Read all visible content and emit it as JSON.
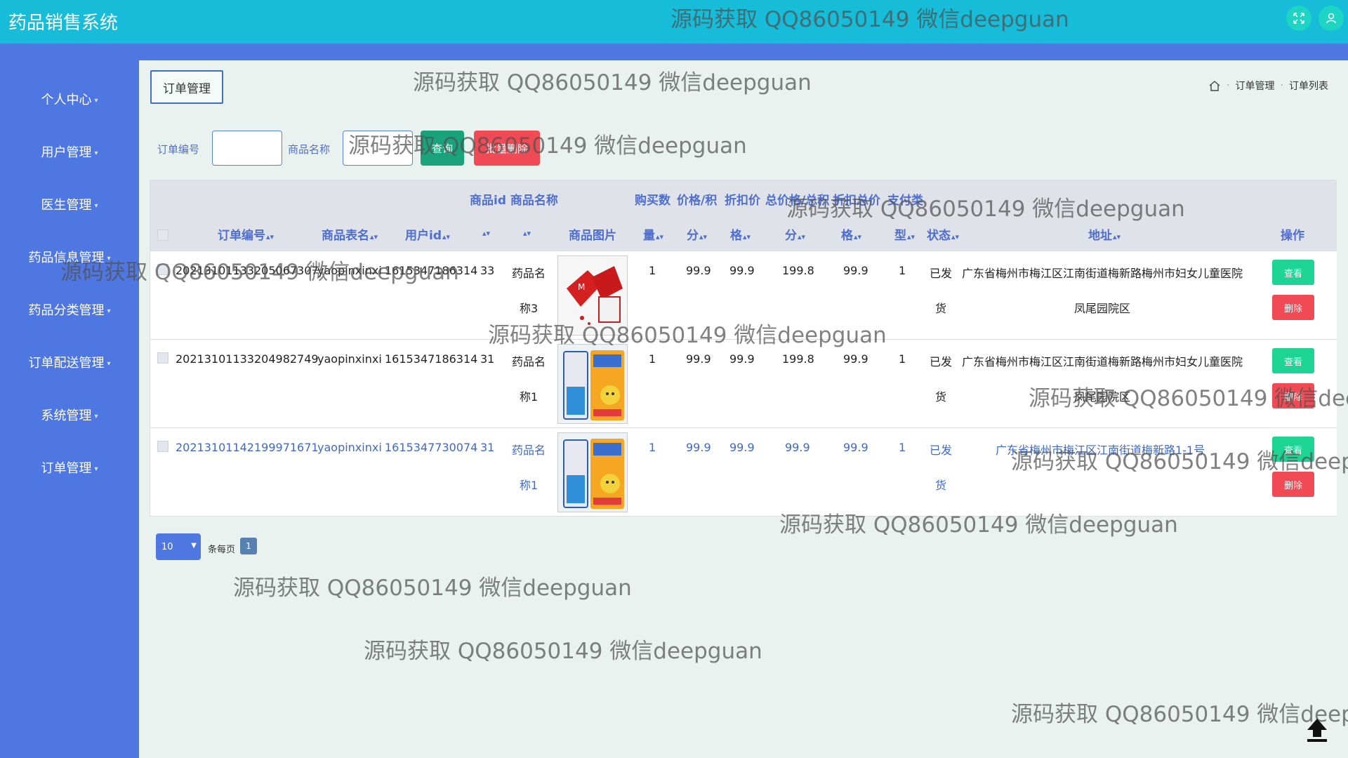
{
  "app": {
    "title": "药品销售系统"
  },
  "header_icons": [
    "fullscreen-icon",
    "user-icon"
  ],
  "sidebar": {
    "items": [
      {
        "label": "个人中心"
      },
      {
        "label": "用户管理"
      },
      {
        "label": "医生管理"
      },
      {
        "label": "药品信息管理"
      },
      {
        "label": "药品分类管理"
      },
      {
        "label": "订单配送管理"
      },
      {
        "label": "系统管理"
      },
      {
        "label": "订单管理"
      }
    ]
  },
  "page": {
    "tab_label": "订单管理",
    "breadcrumb": [
      "订单管理",
      "订单列表"
    ]
  },
  "search": {
    "order_no_label": "订单编号",
    "order_no_value": "",
    "product_name_label": "商品名称",
    "product_name_value": "",
    "query_button": "查询",
    "batch_delete_button": "批量删除"
  },
  "table": {
    "header_top": {
      "goods": "商品id 商品名称",
      "quantity": "购买数",
      "price": "价格/积",
      "discount": "折扣价",
      "total": "总价格/总积",
      "total_discount": "折扣总价",
      "payment": "支付类"
    },
    "header_bottom": {
      "order_no": "订单编号",
      "table_name": "商品表名",
      "user_id": "用户id",
      "goods_id": "",
      "goods_name": "",
      "image": "商品图片",
      "quantity": "量",
      "price": "分",
      "discount": "格",
      "total": "分",
      "total_discount": "格",
      "payment": "型",
      "status": "状态",
      "address": "地址",
      "actions": "操作"
    },
    "rows": [
      {
        "order_no": "20213101133205067307",
        "table_name": "yaopinxinxi",
        "user_id": "1615347186314",
        "goods_id": "33",
        "goods_name_1": "药品名",
        "goods_name_2": "称3",
        "quantity": "1",
        "price": "99.9",
        "discount": "99.9",
        "total": "199.8",
        "total_discount": "99.9",
        "payment": "1",
        "status_1": "已发",
        "status_2": "货",
        "address_1": "广东省梅州市梅江区江南街道梅新路梅州市妇女儿童医院",
        "address_2": "凤尾园院区",
        "view": "查看",
        "delete": "删除"
      },
      {
        "order_no": "20213101133204982749",
        "table_name": "yaopinxinxi",
        "user_id": "1615347186314",
        "goods_id": "31",
        "goods_name_1": "药品名",
        "goods_name_2": "称1",
        "quantity": "1",
        "price": "99.9",
        "discount": "99.9",
        "total": "199.8",
        "total_discount": "99.9",
        "payment": "1",
        "status_1": "已发",
        "status_2": "货",
        "address_1": "广东省梅州市梅江区江南街道梅新路梅州市妇女儿童医院",
        "address_2": "凤尾园院区",
        "view": "查看",
        "delete": "删除"
      },
      {
        "order_no": "20213101142199971671",
        "table_name": "yaopinxinxi",
        "user_id": "1615347730074",
        "goods_id": "31",
        "goods_name_1": "药品名",
        "goods_name_2": "称1",
        "quantity": "1",
        "price": "99.9",
        "discount": "99.9",
        "total": "99.9",
        "total_discount": "99.9",
        "payment": "1",
        "status_1": "已发",
        "status_2": "货",
        "address_1": "广东省梅州市梅江区江南街道梅新路1-1号",
        "address_2": "",
        "view": "查看",
        "delete": "删除"
      }
    ]
  },
  "pagination": {
    "page_size": "10",
    "per_page_label": "条每页",
    "current_page": "1"
  },
  "watermark_text": "源码获取 QQ86050149 微信deepguan",
  "colors": {
    "header": "#16bcd8",
    "sidebar": "#4f77e2",
    "view_button": "#1ed495",
    "delete_button": "#f04b55",
    "query_button": "#1aa37a"
  }
}
